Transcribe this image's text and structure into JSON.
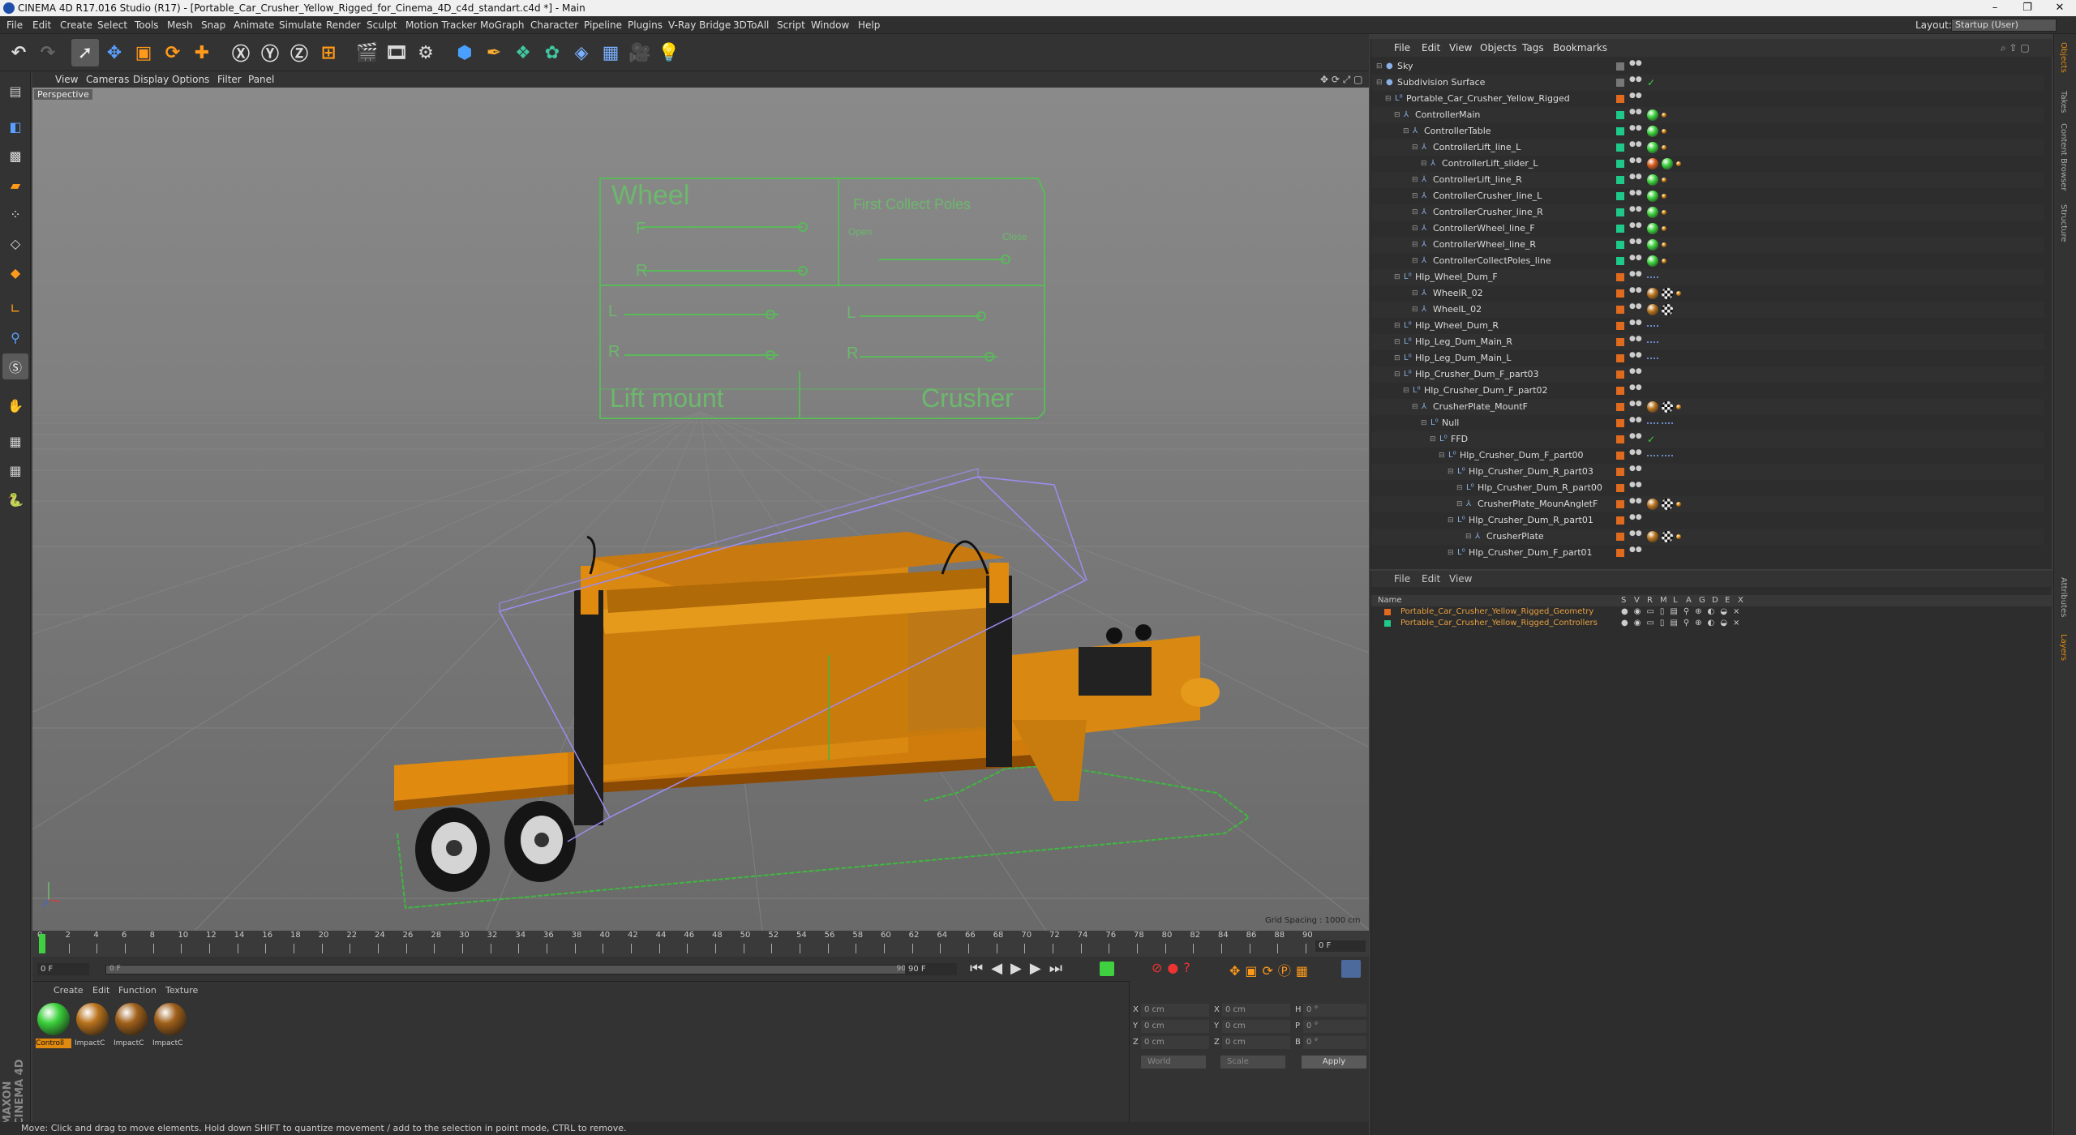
{
  "window": {
    "title": "CINEMA 4D R17.016 Studio (R17) - [Portable_Car_Crusher_Yellow_Rigged_for_Cinema_4D_c4d_standart.c4d *] - Main",
    "minimize": "–",
    "maximize": "❐",
    "close": "✕"
  },
  "menu": [
    "File",
    "Edit",
    "Create",
    "Select",
    "Tools",
    "Mesh",
    "Snap",
    "Animate",
    "Simulate",
    "Render",
    "Sculpt",
    "Motion Tracker",
    "MoGraph",
    "Character",
    "Pipeline",
    "Plugins",
    "V-Ray Bridge",
    "3DToAll",
    "Script",
    "Window",
    "Help"
  ],
  "layout": {
    "label": "Layout:",
    "value": "Startup (User)"
  },
  "viewport": {
    "menu": [
      "View",
      "Cameras",
      "Display",
      "Options",
      "Filter",
      "Panel"
    ],
    "label": "Perspective",
    "grid_spacing": "Grid Spacing : 1000 cm",
    "hud": {
      "wheel": "Wheel",
      "f": "F",
      "r": "R",
      "first_collect": "First Collect Poles",
      "open": "Open",
      "close": "Close",
      "l1": "L",
      "r1": "R",
      "l2": "L",
      "r2": "R",
      "lift_mount": "Lift mount",
      "crusher": "Crusher"
    }
  },
  "timeline": {
    "ticks": [
      "0",
      "2",
      "4",
      "6",
      "8",
      "10",
      "12",
      "14",
      "16",
      "18",
      "20",
      "22",
      "24",
      "26",
      "28",
      "30",
      "32",
      "34",
      "36",
      "38",
      "40",
      "42",
      "44",
      "46",
      "48",
      "50",
      "52",
      "54",
      "56",
      "58",
      "60",
      "62",
      "64",
      "66",
      "68",
      "70",
      "72",
      "74",
      "76",
      "78",
      "80",
      "82",
      "84",
      "86",
      "88",
      "90"
    ],
    "current_frame": "0 F",
    "start": "0 F",
    "range_start": "0 F",
    "range_end": "90 F",
    "end": "90 F"
  },
  "materials": {
    "menu": [
      "Create",
      "Edit",
      "Function",
      "Texture"
    ],
    "items": [
      {
        "label": "Controll",
        "color": "#3bd13b"
      },
      {
        "label": "ImpactC",
        "color": "#b8721c"
      },
      {
        "label": "ImpactC",
        "color": "#a0601a"
      },
      {
        "label": "ImpactC",
        "color": "#a0601a"
      }
    ]
  },
  "coords": {
    "x_label": "X",
    "y_label": "Y",
    "z_label": "Z",
    "x2_label": "X",
    "y2_label": "Y",
    "z2_label": "Z",
    "h_label": "H",
    "p_label": "P",
    "b_label": "B",
    "x": "0 cm",
    "y": "0 cm",
    "z": "0 cm",
    "x2": "0 cm",
    "y2": "0 cm",
    "z2": "0 cm",
    "h": "0 °",
    "p": "0 °",
    "b": "0 °",
    "world": "World",
    "scale": "Scale",
    "apply": "Apply"
  },
  "status": "Move: Click and drag to move elements. Hold down SHIFT to quantize movement / add to the selection in point mode, CTRL to remove.",
  "object_manager": {
    "menu": [
      "File",
      "Edit",
      "View",
      "Objects",
      "Tags",
      "Bookmarks"
    ],
    "rows": [
      {
        "name": "Sky",
        "indent": 0,
        "layer": "#777777",
        "tags": []
      },
      {
        "name": "Subdivision Surface",
        "indent": 0,
        "layer": "#777777",
        "tags": [
          "check"
        ]
      },
      {
        "name": "Portable_Car_Crusher_Yellow_Rigged",
        "indent": 1,
        "layer": "#e06a1e",
        "tags": []
      },
      {
        "name": "ControllerMain",
        "indent": 2,
        "layer": "#1ec98a",
        "tags": [
          "green",
          "dot"
        ]
      },
      {
        "name": "ControllerTable",
        "indent": 3,
        "layer": "#1ec98a",
        "tags": [
          "green",
          "dot"
        ]
      },
      {
        "name": "ControllerLift_line_L",
        "indent": 4,
        "layer": "#1ec98a",
        "tags": [
          "green",
          "dot"
        ]
      },
      {
        "name": "ControllerLift_slider_L",
        "indent": 5,
        "layer": "#1ec98a",
        "tags": [
          "warn",
          "green",
          "dot"
        ]
      },
      {
        "name": "ControllerLift_line_R",
        "indent": 4,
        "layer": "#1ec98a",
        "tags": [
          "green",
          "dot"
        ]
      },
      {
        "name": "ControllerCrusher_line_L",
        "indent": 4,
        "layer": "#1ec98a",
        "tags": [
          "green",
          "dot"
        ]
      },
      {
        "name": "ControllerCrusher_line_R",
        "indent": 4,
        "layer": "#1ec98a",
        "tags": [
          "green",
          "dot"
        ]
      },
      {
        "name": "ControllerWheel_line_F",
        "indent": 4,
        "layer": "#1ec98a",
        "tags": [
          "green",
          "dot"
        ]
      },
      {
        "name": "ControllerWheel_line_R",
        "indent": 4,
        "layer": "#1ec98a",
        "tags": [
          "green",
          "dot"
        ]
      },
      {
        "name": "ControllerCollectPoles_line",
        "indent": 4,
        "layer": "#1ec98a",
        "tags": [
          "green",
          "dot"
        ]
      },
      {
        "name": "Hlp_Wheel_Dum_F",
        "indent": 2,
        "layer": "#e06a1e",
        "tags": [
          "pts"
        ]
      },
      {
        "name": "WheelR_02",
        "indent": 4,
        "layer": "#e06a1e",
        "tags": [
          "mat",
          "chk",
          "dot"
        ]
      },
      {
        "name": "WheelL_02",
        "indent": 4,
        "layer": "#e06a1e",
        "tags": [
          "mat",
          "chk"
        ]
      },
      {
        "name": "Hlp_Wheel_Dum_R",
        "indent": 2,
        "layer": "#e06a1e",
        "tags": [
          "pts"
        ]
      },
      {
        "name": "Hlp_Leg_Dum_Main_R",
        "indent": 2,
        "layer": "#e06a1e",
        "tags": [
          "pts"
        ]
      },
      {
        "name": "Hlp_Leg_Dum_Main_L",
        "indent": 2,
        "layer": "#e06a1e",
        "tags": [
          "pts"
        ]
      },
      {
        "name": "Hlp_Crusher_Dum_F_part03",
        "indent": 2,
        "layer": "#e06a1e",
        "tags": []
      },
      {
        "name": "Hlp_Crusher_Dum_F_part02",
        "indent": 3,
        "layer": "#e06a1e",
        "tags": []
      },
      {
        "name": "CrusherPlate_MountF",
        "indent": 4,
        "layer": "#e06a1e",
        "tags": [
          "mat",
          "chk",
          "dot"
        ]
      },
      {
        "name": "Null",
        "indent": 5,
        "layer": "#e06a1e",
        "tags": [
          "pts",
          "pts"
        ]
      },
      {
        "name": "FFD",
        "indent": 6,
        "layer": "#e06a1e",
        "tags": [
          "check"
        ]
      },
      {
        "name": "Hlp_Crusher_Dum_F_part00",
        "indent": 7,
        "layer": "#e06a1e",
        "tags": [
          "pts",
          "pts"
        ]
      },
      {
        "name": "Hlp_Crusher_Dum_R_part03",
        "indent": 8,
        "layer": "#e06a1e",
        "tags": []
      },
      {
        "name": "Hlp_Crusher_Dum_R_part00",
        "indent": 9,
        "layer": "#e06a1e",
        "tags": []
      },
      {
        "name": "CrusherPlate_MounAngletF",
        "indent": 9,
        "layer": "#e06a1e",
        "tags": [
          "mat",
          "chk",
          "dot"
        ]
      },
      {
        "name": "Hlp_Crusher_Dum_R_part01",
        "indent": 8,
        "layer": "#e06a1e",
        "tags": []
      },
      {
        "name": "CrusherPlate",
        "indent": 10,
        "layer": "#e06a1e",
        "tags": [
          "mat",
          "chk",
          "dot"
        ]
      },
      {
        "name": "Hlp_Crusher_Dum_F_part01",
        "indent": 8,
        "layer": "#e06a1e",
        "tags": []
      }
    ]
  },
  "layer_manager": {
    "menu": [
      "File",
      "Edit",
      "View"
    ],
    "name_header": "Name",
    "flag_headers": [
      "S",
      "V",
      "R",
      "M",
      "L",
      "A",
      "G",
      "D",
      "E",
      "X"
    ],
    "layers": [
      {
        "name": "Portable_Car_Crusher_Yellow_Rigged_Geometry",
        "color": "#e06a1e",
        "text_color": "#e8a040"
      },
      {
        "name": "Portable_Car_Crusher_Yellow_Rigged_Controllers",
        "color": "#1ec98a",
        "text_color": "#e8a040"
      }
    ]
  },
  "right_tabs": [
    "Objects",
    "Takes",
    "Content Browser",
    "Structure",
    "Attributes",
    "Layers"
  ],
  "brand": "MAXON CINEMA 4D"
}
